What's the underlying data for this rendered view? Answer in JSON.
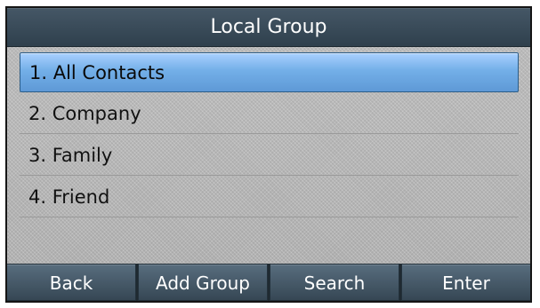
{
  "window": {
    "title": "Local Group"
  },
  "list": {
    "items": [
      {
        "label": "1. All Contacts"
      },
      {
        "label": "2. Company"
      },
      {
        "label": "3. Family"
      },
      {
        "label": "4. Friend"
      }
    ]
  },
  "softkeys": {
    "back": "Back",
    "add_group": "Add Group",
    "search": "Search",
    "enter": "Enter"
  },
  "colors": {
    "title_bar": "#2f404d",
    "selection": "#73afe8",
    "background": "#b9b9b9",
    "softkey": "#364754"
  }
}
